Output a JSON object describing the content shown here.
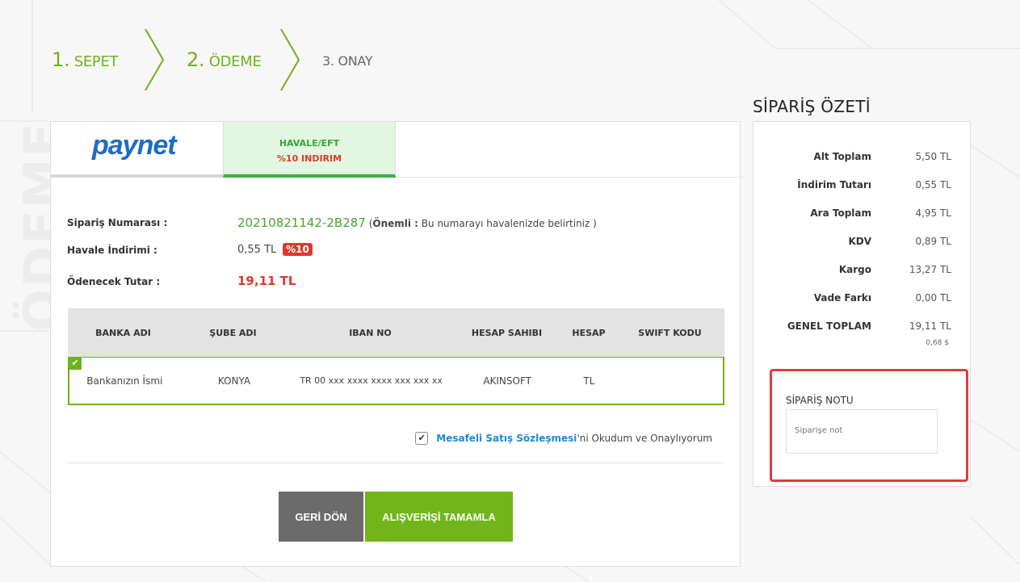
{
  "watermark": "ÖDEME",
  "steps": [
    {
      "num": "1.",
      "label": "SEPET"
    },
    {
      "num": "2.",
      "label": "ÖDEME"
    },
    {
      "num": "3.",
      "label": "ONAY"
    }
  ],
  "payment_tabs": {
    "paynet_logo": "paynet",
    "havale_title": "HAVALE/EFT",
    "havale_discount": "%10 INDIRIM"
  },
  "order_info": {
    "order_number_label": "Sipariş Numarası",
    "order_number": "20210821142-2B287",
    "important_label": "Önemli :",
    "important_text": "Bu numarayı havalenizde belirtiniz )",
    "transfer_discount_label": "Havale İndirimi",
    "transfer_discount_value": "0,55 TL",
    "transfer_discount_badge": "%10",
    "amount_due_label": "Ödenecek Tutar",
    "amount_due_value": "19,11 TL"
  },
  "bank_table": {
    "headers": [
      "BANKA ADI",
      "ŞUBE ADI",
      "IBAN NO",
      "HESAP SAHIBI",
      "HESAP",
      "SWIFT KODU"
    ],
    "rows": [
      [
        "Bankanızın İsmi",
        "KONYA",
        "TR 00 xxx xxxx xxxx xxx xxx xx",
        "AKINSOFT",
        "TL",
        ""
      ]
    ]
  },
  "agreement": {
    "link_text": "Mesafeli Satış Sözleşmesi",
    "suffix_text": "'ni Okudum ve Onaylıyorum",
    "checked": true
  },
  "buttons": {
    "back": "GERİ DÖN",
    "complete": "ALIŞVERİŞİ TAMAMLA"
  },
  "summary": {
    "title": "SİPARİŞ ÖZETİ",
    "rows": [
      {
        "label": "Alt Toplam",
        "value": "5,50 TL"
      },
      {
        "label": "İndirim Tutarı",
        "value": "0,55 TL"
      },
      {
        "label": "Ara Toplam",
        "value": "4,95 TL"
      },
      {
        "label": "KDV",
        "value": "0,89 TL"
      },
      {
        "label": "Kargo",
        "value": "13,27 TL"
      },
      {
        "label": "Vade Farkı",
        "value": "0,00 TL"
      },
      {
        "label": "GENEL TOPLAM",
        "value": "19,11 TL"
      }
    ],
    "usd_total": "0,68 $"
  },
  "order_note": {
    "label": "SİPARİŞ NOTU",
    "placeholder": "Siparişe not"
  },
  "colors": {
    "accent_green": "#6cb31d",
    "discount_red": "#e0382b",
    "link_blue": "#1e8ad6",
    "highlight_box": "#e03c3c"
  }
}
